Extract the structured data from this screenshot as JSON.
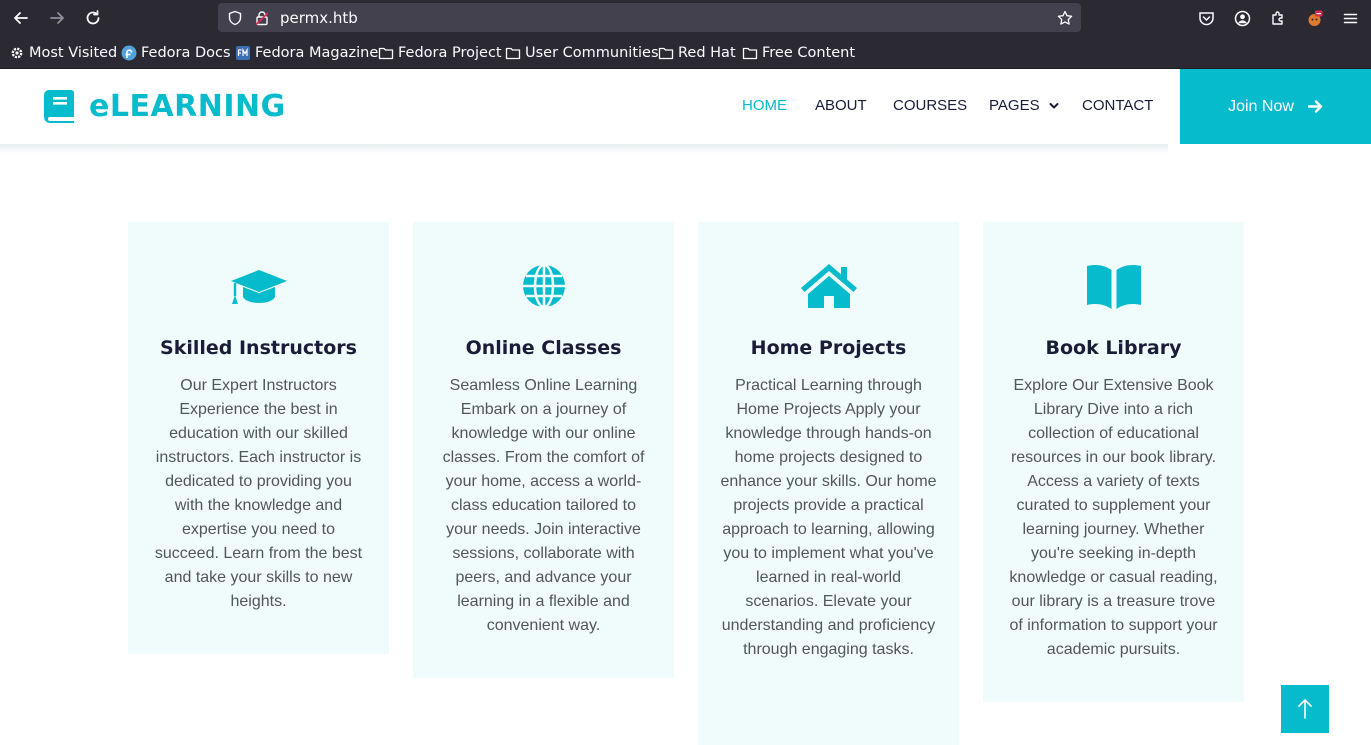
{
  "browser": {
    "url": "permx.htb",
    "bookmarks": [
      {
        "label": "Most Visited",
        "icon": "gear-icon"
      },
      {
        "label": "Fedora Docs",
        "icon": "fedora-icon"
      },
      {
        "label": "Fedora Magazine",
        "icon": "fedora-magazine-icon"
      },
      {
        "label": "Fedora Project",
        "icon": "folder-icon"
      },
      {
        "label": "User Communities",
        "icon": "folder-icon"
      },
      {
        "label": "Red Hat",
        "icon": "folder-icon"
      },
      {
        "label": "Free Content",
        "icon": "folder-icon"
      }
    ]
  },
  "header": {
    "brand": "eLEARNING",
    "nav": [
      {
        "label": "HOME",
        "active": true
      },
      {
        "label": "ABOUT",
        "active": false
      },
      {
        "label": "COURSES",
        "active": false
      },
      {
        "label": "PAGES",
        "active": false,
        "dropdown": true
      },
      {
        "label": "CONTACT",
        "active": false
      }
    ],
    "cta": "Join Now"
  },
  "features": [
    {
      "icon": "graduation-cap-icon",
      "title": "Skilled Instructors",
      "text": "Our Expert Instructors Experience the best in education with our skilled instructors. Each instructor is dedicated to providing you with the knowledge and expertise you need to succeed. Learn from the best and take your skills to new heights."
    },
    {
      "icon": "globe-icon",
      "title": "Online Classes",
      "text": "Seamless Online Learning Embark on a journey of knowledge with our online classes. From the comfort of your home, access a world-class education tailored to your needs. Join interactive sessions, collaborate with peers, and advance your learning in a flexible and convenient way."
    },
    {
      "icon": "home-icon",
      "title": "Home Projects",
      "text": "Practical Learning through Home Projects Apply your knowledge through hands-on home projects designed to enhance your skills. Our home projects provide a practical approach to learning, allowing you to implement what you've learned in real-world scenarios. Elevate your understanding and proficiency through engaging tasks."
    },
    {
      "icon": "book-open-icon",
      "title": "Book Library",
      "text": "Explore Our Extensive Book Library Dive into a rich collection of educational resources in our book library. Access a variety of texts curated to supplement your learning journey. Whether you're seeking in-depth knowledge or casual reading, our library is a treasure trove of information to support your academic pursuits."
    }
  ],
  "colors": {
    "accent": "#06bbcc",
    "dark": "#181d38",
    "card_bg": "#f0fbfc",
    "body_text": "#52565b"
  }
}
